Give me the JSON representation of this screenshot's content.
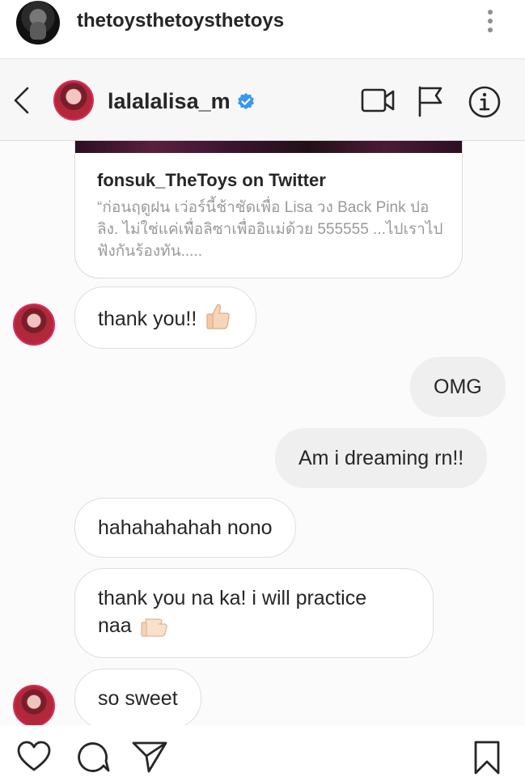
{
  "post": {
    "username": "thetoysthetoysthetoys",
    "icons": {
      "avatar": "profile-photo",
      "more": "more-vertical-icon"
    }
  },
  "dm": {
    "contact_name": "lalalalisa_m",
    "colors": {
      "verified": "#3897f0",
      "avatar_ring": "#d82f5f",
      "outgoing_bubble": "#efefef",
      "incoming_border": "#dedede"
    },
    "icons": [
      "back-icon",
      "verified-badge-icon",
      "video-call-icon",
      "flag-icon",
      "info-icon"
    ],
    "link_card": {
      "title": "fonsuk_TheToys on Twitter",
      "description": "“ก่อนฤดูฝน เว่อร์นี้ช้าชัดเพื่อ Lisa วง Back Pink ปอลิง. ไม่ใช่แค่เพื่อลิซาเพื่ออิแม่ด้วย 555555 ...ไปเราไปฟังกันร้องทัน....."
    },
    "messages": [
      {
        "from": "them",
        "text": "thank you!!",
        "emoji": "thumbs-up"
      },
      {
        "from": "me",
        "text": "OMG"
      },
      {
        "from": "me",
        "text": "Am i dreaming rn!!"
      },
      {
        "from": "them",
        "text": "hahahahahah nono"
      },
      {
        "from": "them",
        "line1": "thank you na ka! i will practice",
        "line2": "naa",
        "emoji": "thumbs-up"
      },
      {
        "from": "them",
        "text": "so sweet"
      }
    ]
  },
  "actions": [
    "heart-icon",
    "comment-icon",
    "share-icon",
    "bookmark-icon"
  ]
}
